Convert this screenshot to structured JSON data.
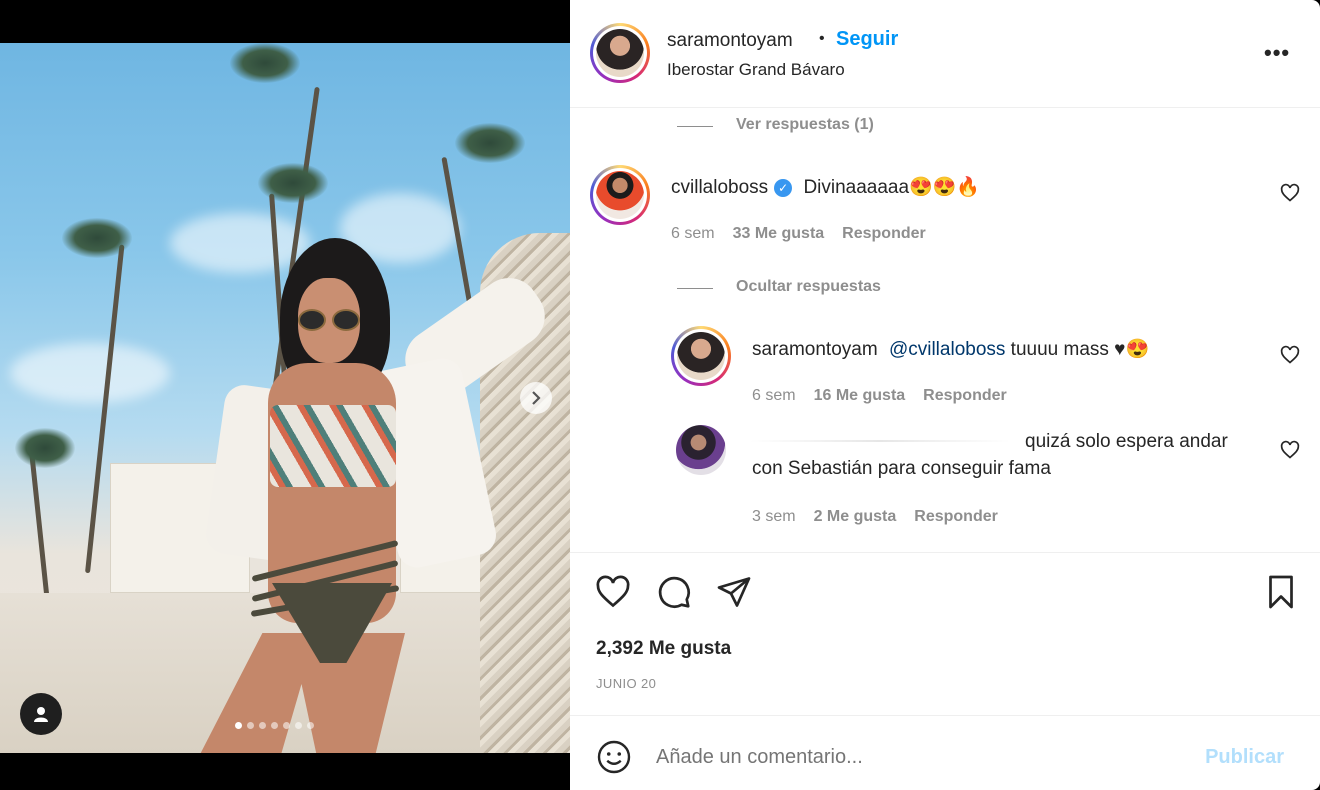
{
  "post": {
    "author": "saramontoyam",
    "follow_label": "Seguir",
    "separator": "•",
    "location": "Iberostar Grand Bávaro",
    "more_label": "•••"
  },
  "comments": {
    "thread1_view_replies": "Ver respuestas (1)",
    "c1": {
      "user": "cvillaloboss",
      "verified": true,
      "text": "Divinaaaaaa😍😍🔥",
      "time": "6 sem",
      "likes": "33 Me gusta",
      "reply": "Responder"
    },
    "hide_replies": "Ocultar respuestas",
    "r1": {
      "user": "saramontoyam",
      "mention": "@cvillaloboss",
      "text": " tuuuu mass ♥😍",
      "time": "6 sem",
      "likes": "16 Me gusta",
      "reply": "Responder"
    },
    "r2": {
      "text_line1": "quizá solo espera andar",
      "text_line2": "con Sebastián para conseguir fama",
      "time": "3 sem",
      "likes": "2 Me gusta",
      "reply": "Responder"
    }
  },
  "footer": {
    "likes": "2,392 Me gusta",
    "date": "JUNIO 20",
    "comment_placeholder": "Añade un comentario...",
    "publish_label": "Publicar"
  },
  "carousel": {
    "total_slides": 7,
    "active_slide": 1
  },
  "colors": {
    "follow_blue": "#0095f6",
    "publish_disabled": "#b2dffc",
    "verified_blue": "#3897f0",
    "muted_text": "#8e8e8e"
  },
  "icons": [
    "next-chevron-icon",
    "user-tag-icon",
    "more-options-icon",
    "verified-icon",
    "heart-icon",
    "comment-icon",
    "share-icon",
    "bookmark-icon",
    "emoji-icon"
  ]
}
